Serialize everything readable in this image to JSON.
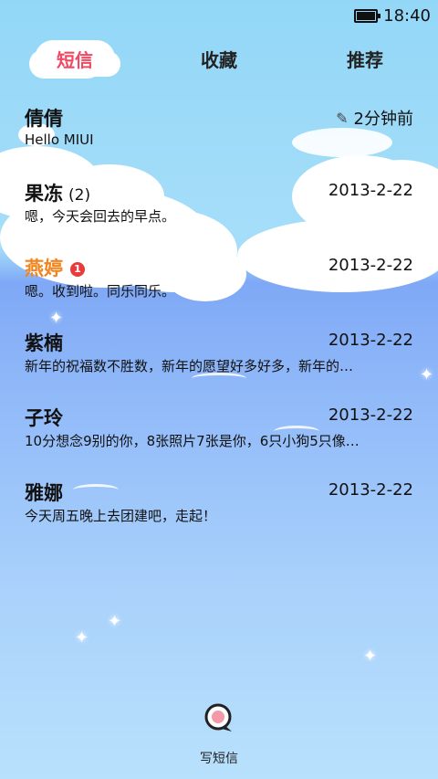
{
  "status_bar": {
    "time": "18:40"
  },
  "tabs": [
    {
      "label": "短信",
      "active": true
    },
    {
      "label": "收藏",
      "active": false
    },
    {
      "label": "推荐",
      "active": false
    }
  ],
  "conversations": [
    {
      "name": "倩倩",
      "count": "",
      "badge": "",
      "time": "2分钟前",
      "preview": "Hello MIUI",
      "highlight": false,
      "draft": true
    },
    {
      "name": "果冻",
      "count": "(2)",
      "badge": "",
      "time": "2013-2-22",
      "preview": "嗯，今天会回去的早点。",
      "highlight": false,
      "draft": false
    },
    {
      "name": "燕婷",
      "count": "",
      "badge": "1",
      "time": "2013-2-22",
      "preview": "嗯。收到啦。同乐同乐。",
      "highlight": true,
      "draft": false
    },
    {
      "name": "紫楠",
      "count": "",
      "badge": "",
      "time": "2013-2-22",
      "preview": "新年的祝福数不胜数，新年的愿望好多好多，新年的…",
      "highlight": false,
      "draft": false
    },
    {
      "name": "子玲",
      "count": "",
      "badge": "",
      "time": "2013-2-22",
      "preview": "10分想念9别的你，8张照片7张是你，6只小狗5只像…",
      "highlight": false,
      "draft": false
    },
    {
      "name": "雅娜",
      "count": "",
      "badge": "",
      "time": "2013-2-22",
      "preview": "今天周五晚上去团建吧，走起！",
      "highlight": false,
      "draft": false
    }
  ],
  "compose": {
    "label": "写短信",
    "icon": "compose-bubble-icon"
  },
  "colors": {
    "accent": "#ef4a64",
    "highlight_name": "#f2841e",
    "badge": "#e83b3b"
  }
}
